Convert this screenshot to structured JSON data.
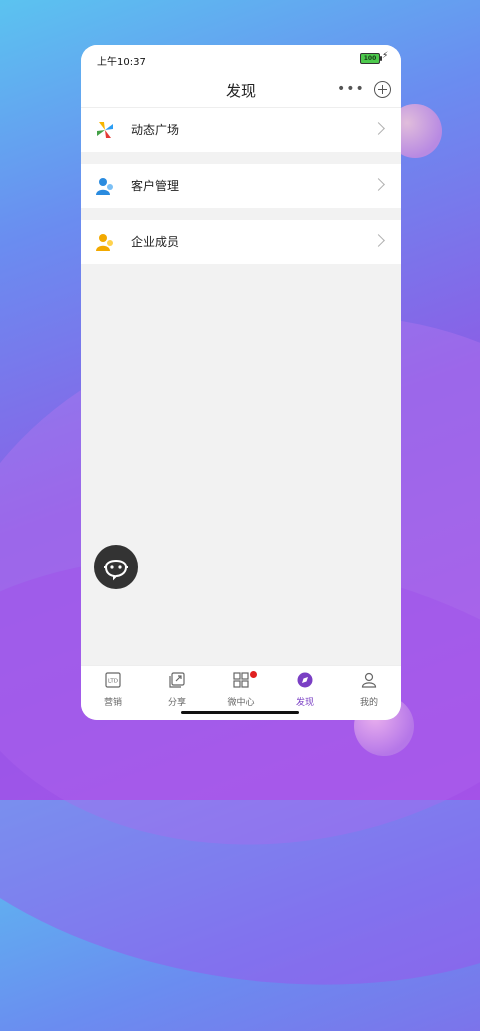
{
  "status_bar": {
    "time": "上午10:37",
    "battery": "100"
  },
  "header": {
    "title": "发现"
  },
  "menu": [
    {
      "label": "动态广场",
      "icon": "pinwheel-icon"
    },
    {
      "label": "客户管理",
      "icon": "customer-icon"
    },
    {
      "label": "企业成员",
      "icon": "member-icon"
    }
  ],
  "tabs": [
    {
      "label": "营销",
      "icon": "ltd-icon"
    },
    {
      "label": "分享",
      "icon": "share-icon"
    },
    {
      "label": "微中心",
      "icon": "grid-icon"
    },
    {
      "label": "发现",
      "icon": "compass-icon",
      "active": true
    },
    {
      "label": "我的",
      "icon": "person-icon"
    }
  ],
  "colors": {
    "accent": "#7a3fc4",
    "badge": "#e02020"
  }
}
